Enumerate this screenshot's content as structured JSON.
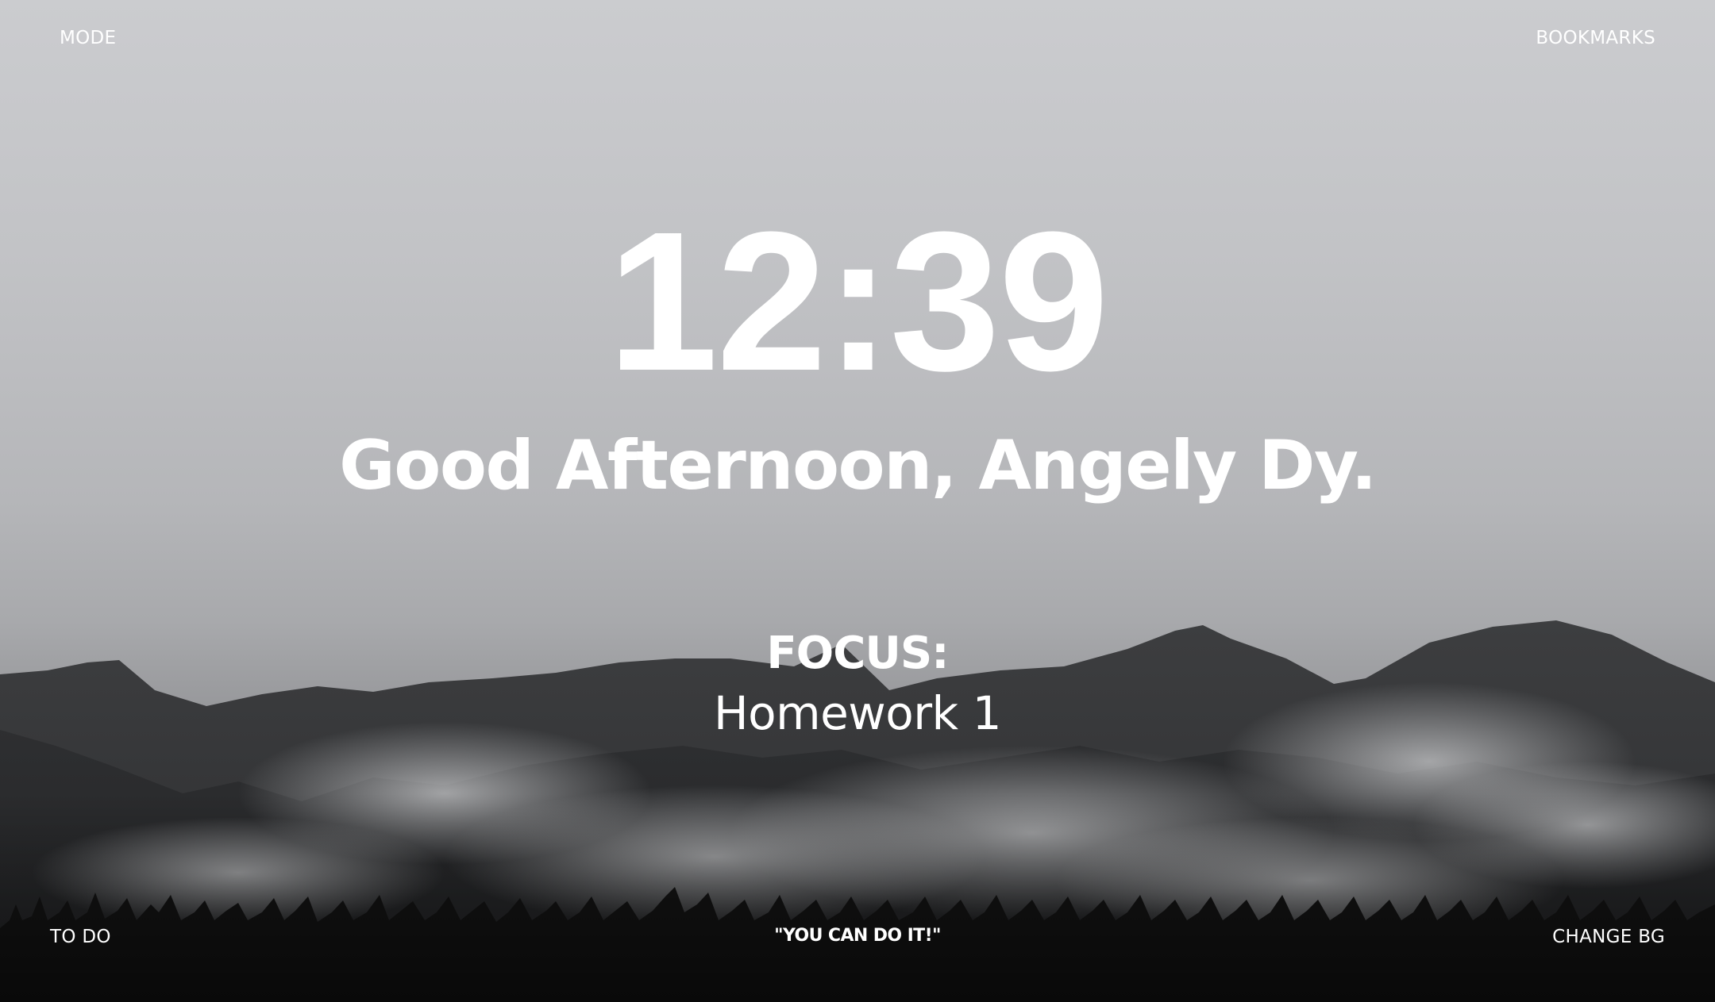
{
  "top_bar": {
    "mode_label": "MODE",
    "bookmarks_label": "BOOKMARKS"
  },
  "clock": {
    "time": "12:39"
  },
  "greeting": {
    "text": "Good Afternoon, Angely Dy."
  },
  "focus": {
    "label": "FOCUS:",
    "value": "Homework 1"
  },
  "bottom_bar": {
    "todo_label": "TO DO",
    "quote": "\"YOU CAN DO IT!\"",
    "change_bg_label": "CHANGE BG"
  },
  "background": {
    "description_icon": "mountain-forest-background",
    "colors": {
      "sky": "#c6c7ca",
      "mountains": "#3a3b3d",
      "trees": "#141414"
    }
  }
}
